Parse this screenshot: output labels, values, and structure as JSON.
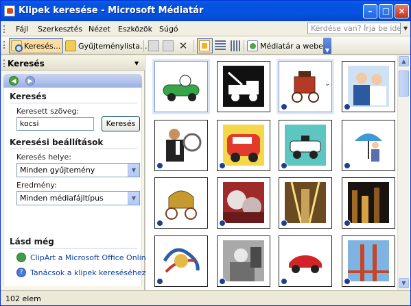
{
  "window": {
    "title": "Klipek keresése - Microsoft Médiatár"
  },
  "menubar": {
    "items": [
      {
        "label": "Fájl"
      },
      {
        "label": "Szerkesztés"
      },
      {
        "label": "Nézet"
      },
      {
        "label": "Eszközök"
      },
      {
        "label": "Súgó"
      }
    ],
    "help_placeholder": "Kérdése van? Írja be ide."
  },
  "toolbar": {
    "search_label": "Keresés...",
    "collections_label": "Gyűjteménylista...",
    "online_label": "Médiatár a weben"
  },
  "pane": {
    "title": "Keresés",
    "search_section": "Keresés",
    "search_text_label": "Keresett szöveg:",
    "search_value": "kocsi",
    "search_button": "Keresés",
    "options_section": "Keresési beállítások",
    "location_label": "Keresés helye:",
    "location_value": "Minden gyűjtemény",
    "results_label": "Eredmény:",
    "results_value": "Minden médiafájltípus",
    "see_also_section": "Lásd még",
    "link_online": "ClipArt a Microsoft Office Online w",
    "link_tips": "Tanácsok a klipek kereséséhez"
  },
  "gallery": {
    "items": [
      {
        "icon": "race-car-clipart-icon"
      },
      {
        "icon": "tow-truck-clipart-icon"
      },
      {
        "icon": "carriage-clipart-icon"
      },
      {
        "icon": "people-photo-icon"
      },
      {
        "icon": "driver-clipart-icon"
      },
      {
        "icon": "taxi-clipart-icon"
      },
      {
        "icon": "police-car-clipart-icon"
      },
      {
        "icon": "person-umbrella-clipart-icon"
      },
      {
        "icon": "coach-clipart-icon"
      },
      {
        "icon": "car-detail-photo-icon"
      },
      {
        "icon": "tunnel-photo-icon"
      },
      {
        "icon": "night-city-photo-icon"
      },
      {
        "icon": "abstract-clipart-icon"
      },
      {
        "icon": "person-in-car-photo-icon"
      },
      {
        "icon": "sports-car-photo-icon"
      },
      {
        "icon": "bridge-photo-icon"
      }
    ]
  },
  "status": {
    "text": "102 elem"
  },
  "colors": {
    "titlebar": "#0453e0",
    "link": "#0a3ea6",
    "selection": "#dfe7f6"
  }
}
